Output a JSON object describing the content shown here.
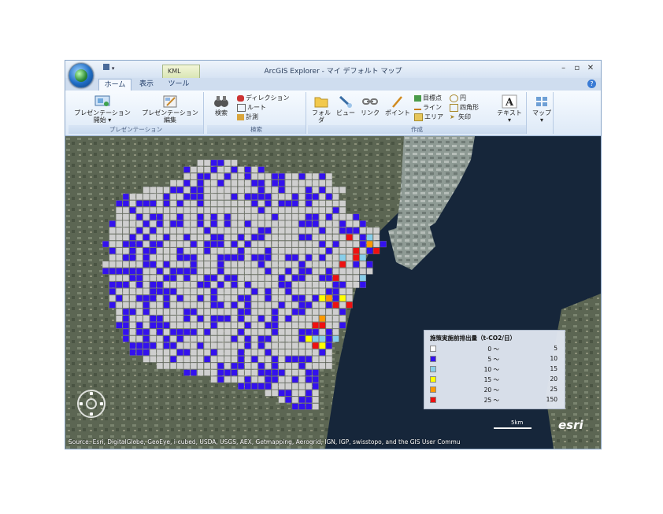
{
  "window": {
    "title": "ArcGIS Explorer - マイ デフォルト マップ"
  },
  "contextual_tab": "KML",
  "tabs": [
    {
      "label": "ホーム",
      "active": true
    },
    {
      "label": "表示",
      "active": false
    },
    {
      "label": "ツール",
      "active": false
    }
  ],
  "ribbon": {
    "presentation": {
      "label": "プレゼンテーション",
      "start_line1": "プレゼンテーション",
      "start_line2": "開始",
      "edit_line1": "プレゼンテーション",
      "edit_line2": "編集"
    },
    "search": {
      "label": "検索",
      "search": "検索",
      "direction": "ディレクション",
      "route": "ルート",
      "measure": "計測"
    },
    "create": {
      "label": "作成",
      "folder": "フォルダ",
      "view": "ビュー",
      "link": "リンク",
      "point": "ポイント",
      "landmark": "目標点",
      "line": "ライン",
      "area": "エリア",
      "circle": "円",
      "rectangle": "四角形",
      "arrow": "矢印",
      "text": "テキスト"
    },
    "map": {
      "map": "マップ"
    }
  },
  "legend": {
    "title": "施策実施前排出量（t-CO2/日）",
    "tilde": "～",
    "rows": [
      {
        "color": "#ffffff",
        "min": "0",
        "max": "5"
      },
      {
        "color": "#3311ee",
        "min": "5",
        "max": "10"
      },
      {
        "color": "#87ceeb",
        "min": "10",
        "max": "15"
      },
      {
        "color": "#ffff00",
        "min": "15",
        "max": "20"
      },
      {
        "color": "#ff9900",
        "min": "20",
        "max": "25"
      },
      {
        "color": "#ee1111",
        "min": "25",
        "max": "150"
      }
    ]
  },
  "map": {
    "attribution": "Source: Esri, DigitalGlobe, GeoEye, i-cubed, USDA, USGS, AEX, Getmapping, Aerogrid, IGN, IGP, swisstopo, and the GIS User Commu",
    "esri_logo": "esri",
    "scale_label": "5km"
  }
}
